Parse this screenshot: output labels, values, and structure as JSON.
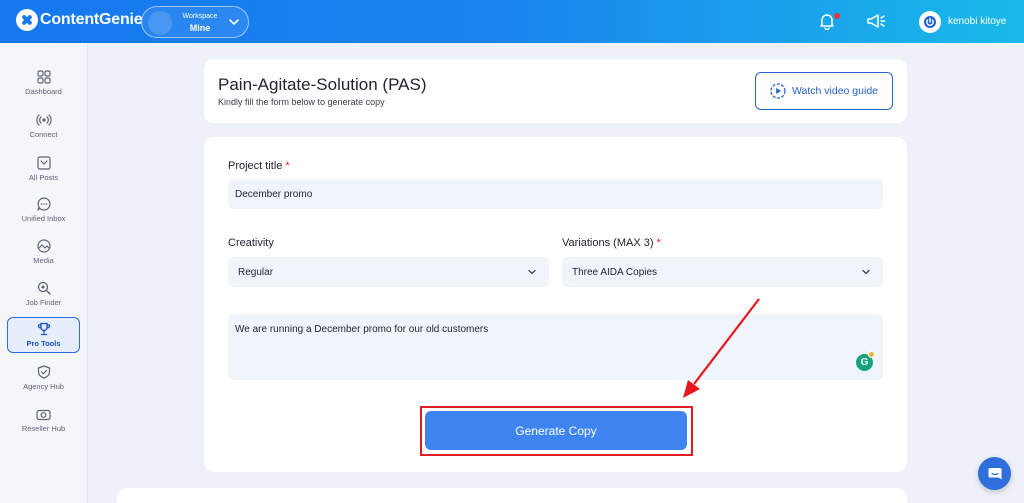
{
  "app": {
    "name": "ContentGenie"
  },
  "workspace": {
    "label": "Workspace",
    "name": "Mine"
  },
  "user": {
    "name": "kenobi kitoye"
  },
  "sidebar": {
    "items": [
      {
        "label": "Dashboard",
        "icon": "grid-icon"
      },
      {
        "label": "Connect",
        "icon": "broadcast-icon"
      },
      {
        "label": "All Posts",
        "icon": "inbox-icon"
      },
      {
        "label": "Unified Inbox",
        "icon": "chat-icon"
      },
      {
        "label": "Media",
        "icon": "image-icon"
      },
      {
        "label": "Job Finder",
        "icon": "search-icon"
      },
      {
        "label": "Pro Tools",
        "icon": "trophy-icon",
        "active": true
      },
      {
        "label": "Agency Hub",
        "icon": "shield-icon"
      },
      {
        "label": "Reseller Hub",
        "icon": "camera-icon"
      }
    ]
  },
  "header": {
    "title": "Pain-Agitate-Solution (PAS)",
    "subtitle": "Kindly fill the form below to generate copy",
    "video_button": "Watch video guide"
  },
  "form": {
    "project_title_label": "Project title",
    "project_title_value": "December promo",
    "creativity_label": "Creativity",
    "creativity_value": "Regular",
    "variations_label": "Variations (MAX 3)",
    "variations_value": "Three AIDA Copies",
    "description_value": "We are running a December promo for our old customers",
    "required_marker": "*",
    "submit_label": "Generate Copy"
  },
  "colors": {
    "brand": "#1677f0",
    "accent_button": "#3d84f0",
    "highlight": "#e01f27",
    "required": "#e02424"
  }
}
